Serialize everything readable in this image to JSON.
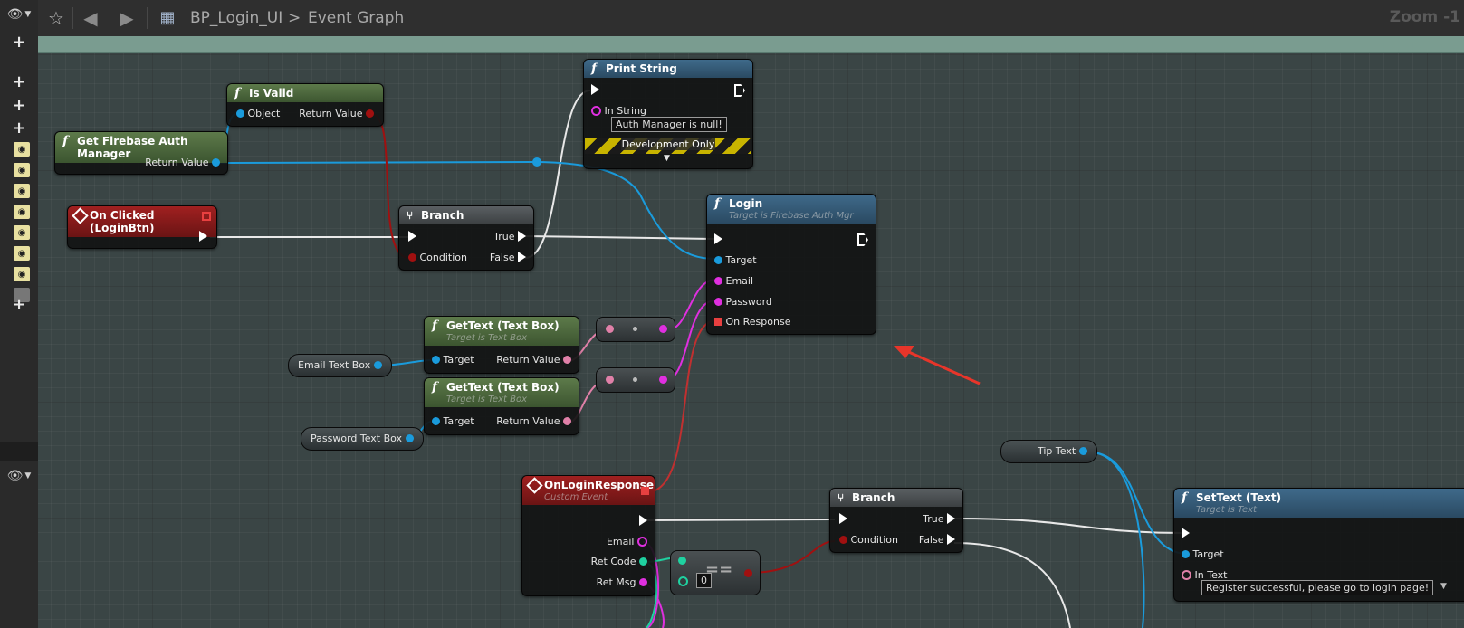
{
  "toolbar": {
    "breadcrumb_blueprint": "BP_Login_UI",
    "breadcrumb_separator": ">",
    "breadcrumb_graph": "Event Graph",
    "zoom_label": "Zoom -1"
  },
  "nodes": {
    "is_valid": {
      "title": "Is Valid",
      "pin_object": "Object",
      "pin_return": "Return Value"
    },
    "get_auth_manager": {
      "title": "Get Firebase Auth Manager",
      "pin_return": "Return Value"
    },
    "on_clicked": {
      "title": "On Clicked (LoginBtn)"
    },
    "branch1": {
      "title": "Branch",
      "pin_condition": "Condition",
      "pin_true": "True",
      "pin_false": "False"
    },
    "print_string": {
      "title": "Print String",
      "pin_in_string": "In String",
      "in_string_value": "Auth Manager is null!",
      "dev_only": "Development Only"
    },
    "login": {
      "title": "Login",
      "subtitle": "Target is Firebase Auth Mgr",
      "pin_target": "Target",
      "pin_email": "Email",
      "pin_password": "Password",
      "pin_on_response": "On Response"
    },
    "gettext1": {
      "title": "GetText (Text Box)",
      "subtitle": "Target is Text Box",
      "pin_target": "Target",
      "pin_return": "Return Value"
    },
    "gettext2": {
      "title": "GetText (Text Box)",
      "subtitle": "Target is Text Box",
      "pin_target": "Target",
      "pin_return": "Return Value"
    },
    "email_var": {
      "label": "Email Text Box"
    },
    "password_var": {
      "label": "Password Text Box"
    },
    "tip_var": {
      "label": "Tip Text"
    },
    "on_login_response": {
      "title": "OnLoginResponse",
      "subtitle": "Custom Event",
      "pin_email": "Email",
      "pin_retcode": "Ret Code",
      "pin_retmsg": "Ret Msg"
    },
    "equals": {
      "symbol": "==",
      "value": "0"
    },
    "branch2": {
      "title": "Branch",
      "pin_condition": "Condition",
      "pin_true": "True",
      "pin_false": "False"
    },
    "set_text": {
      "title": "SetText (Text)",
      "subtitle": "Target is Text",
      "pin_target": "Target",
      "pin_in_text": "In Text",
      "in_text_value": "Register successful, please go to login page!"
    }
  },
  "colors": {
    "exec": "#ffffff",
    "object": "#1a9bdc",
    "bool": "#a01010",
    "string": "#e02fe0",
    "text": "#e080a8",
    "int": "#1fd1a0",
    "delegate": "#e84040",
    "annotation_arrow": "#e8352a"
  }
}
